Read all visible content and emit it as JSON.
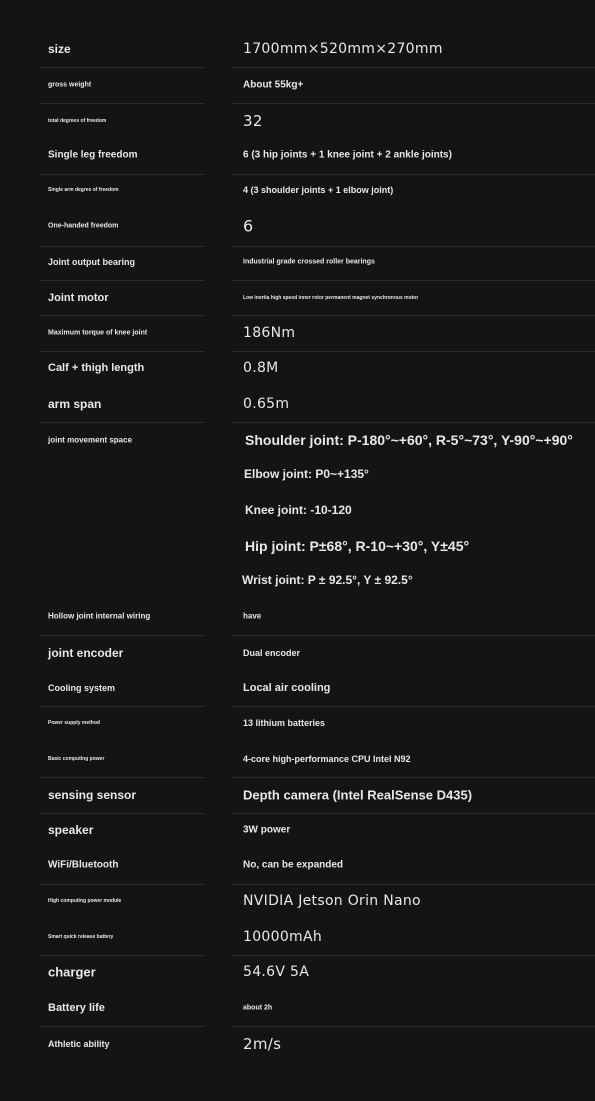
{
  "specs": [
    {
      "label": "size",
      "value": "1700mm×520mm×270mm"
    },
    {
      "label": "gross weight",
      "value": "About 55kg+"
    },
    {
      "label": "total degrees of freedom",
      "value": "32"
    },
    {
      "label": "Single leg freedom",
      "value": "6 (3 hip joints + 1 knee joint + 2 ankle joints)"
    },
    {
      "label": "Single arm degree of freedom",
      "value": "4 (3 shoulder joints + 1 elbow joint)"
    },
    {
      "label": "One-handed freedom",
      "value": "6"
    },
    {
      "label": "Joint output bearing",
      "value": "Industrial grade crossed roller bearings"
    },
    {
      "label": "Joint motor",
      "value": "Low inertia high speed inner rotor permanent magnet synchronous motor"
    },
    {
      "label": "Maximum torque of knee joint",
      "value": "186Nm"
    },
    {
      "label": "Calf + thigh length",
      "value": "0.8M"
    },
    {
      "label": "arm span",
      "value": "0.65m"
    },
    {
      "label": "joint movement space",
      "values": [
        "Shoulder joint: P-180°~+60°, R-5°~73°, Y-90°~+90°",
        "Elbow joint: P0~+135°",
        "Knee joint: -10-120",
        "Hip joint: P±68°, R-10~+30°, Y±45°",
        "Wrist joint: P ± 92.5°, Y ± 92.5°"
      ]
    },
    {
      "label": "Hollow joint internal wiring",
      "value": "have"
    },
    {
      "label": "joint encoder",
      "value": "Dual encoder"
    },
    {
      "label": "Cooling system",
      "value": "Local air cooling"
    },
    {
      "label": "Power supply method",
      "value": "13 lithium batteries"
    },
    {
      "label": "Basic computing power",
      "value": "4-core high-performance CPU Intel N92"
    },
    {
      "label": "sensing sensor",
      "value": "Depth camera (Intel RealSense D435)"
    },
    {
      "label": "speaker",
      "value": "3W power"
    },
    {
      "label": "WiFi/Bluetooth",
      "value": "No, can be expanded"
    },
    {
      "label": "High computing power module",
      "value": "NVIDIA Jetson Orin Nano"
    },
    {
      "label": "Smart quick release battery",
      "value": "10000mAh"
    },
    {
      "label": "charger",
      "value": "54.6V 5A"
    },
    {
      "label": "Battery life",
      "value": "about 2h"
    },
    {
      "label": "Athletic ability",
      "value": "2m/s"
    }
  ]
}
